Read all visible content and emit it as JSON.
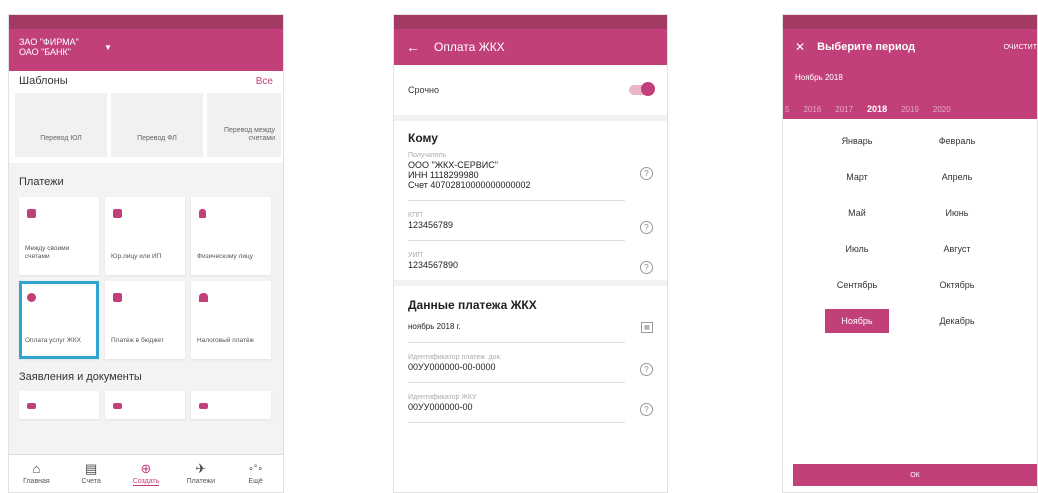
{
  "screen1": {
    "header": {
      "line1": "ЗАО \"ФИРМА\"",
      "line2": "ОАО \"БАНК\""
    },
    "templates": {
      "title": "Шаблоны",
      "all_label": "Все",
      "items": [
        "Перевод ЮЛ",
        "Перевод ФЛ",
        "Перевод между счетами"
      ]
    },
    "payments": {
      "title": "Платежи",
      "items": [
        "Между своими счетами",
        "Юр.лицу или ИП",
        "Физическому лицу",
        "Оплата услуг ЖКХ",
        "Платёж в бюджет",
        "Налоговый платёж"
      ]
    },
    "documents": {
      "title": "Заявления и документы"
    },
    "tabs": [
      "Главная",
      "Счета",
      "Создать",
      "Платежи",
      "Ещё"
    ]
  },
  "screen2": {
    "title": "Оплата ЖКХ",
    "urgent_label": "Срочно",
    "to_title": "Кому",
    "recipient": {
      "label": "Получатель",
      "line1": "ООО \"ЖКХ-СЕРВИС\"",
      "line2": "ИНН 1118299980",
      "line3": "Счет 40702810000000000002"
    },
    "kpp": {
      "label": "КПП",
      "value": "123456789"
    },
    "uip": {
      "label": "УИП",
      "value": "1234567890"
    },
    "data_title": "Данные платежа ЖКХ",
    "period": {
      "value": "ноябрь 2018 г."
    },
    "doc_id": {
      "label": "Идентификатор платеж. док.",
      "value": "00УУ000000-00-0000"
    },
    "zku_id": {
      "label": "Идентификатор ЖКУ",
      "value": "00УУ000000-00"
    }
  },
  "screen3": {
    "title": "Выберите период",
    "clear_label": "ОЧИСТИТ",
    "selected_period": "Ноябрь 2018",
    "years": [
      "5",
      "2016",
      "2017",
      "2018",
      "2019",
      "2020"
    ],
    "months": [
      "Январь",
      "Февраль",
      "Март",
      "Апрель",
      "Май",
      "Июнь",
      "Июль",
      "Август",
      "Сентябрь",
      "Октябрь",
      "Ноябрь",
      "Декабрь"
    ],
    "ok_label": "ОК"
  },
  "colors": {
    "accent": "#c2407a",
    "status": "#a33a64",
    "selection_outline": "#2fa6cf"
  }
}
